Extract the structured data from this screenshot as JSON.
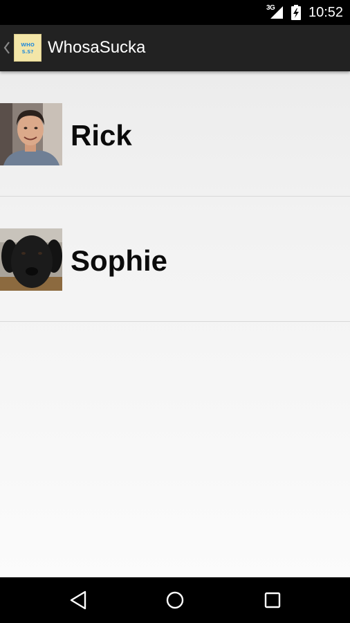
{
  "status_bar": {
    "network_type": "3G",
    "time": "10:52",
    "icons": [
      "signal-icon",
      "battery-icon"
    ]
  },
  "action_bar": {
    "title": "WhosaSucka",
    "app_icon_text_line1": "WHO",
    "app_icon_text_line2": "S.S?",
    "icons": [
      "back-caret-icon",
      "app-logo-icon"
    ]
  },
  "contacts": [
    {
      "name": "Rick",
      "avatar": "man-portrait-photo"
    },
    {
      "name": "Sophie",
      "avatar": "black-dog-photo"
    }
  ],
  "nav_bar": {
    "icons": [
      "back-triangle-icon",
      "home-circle-icon",
      "recents-square-icon"
    ]
  },
  "colors": {
    "status_bar_bg": "#000000",
    "action_bar_bg": "#222222",
    "list_bg": "#f1f1f1",
    "divider": "#d8d8d8",
    "name_text": "#0b0b0b",
    "app_icon_bg": "#f3e6a8",
    "app_icon_text": "#2e8fd8"
  }
}
